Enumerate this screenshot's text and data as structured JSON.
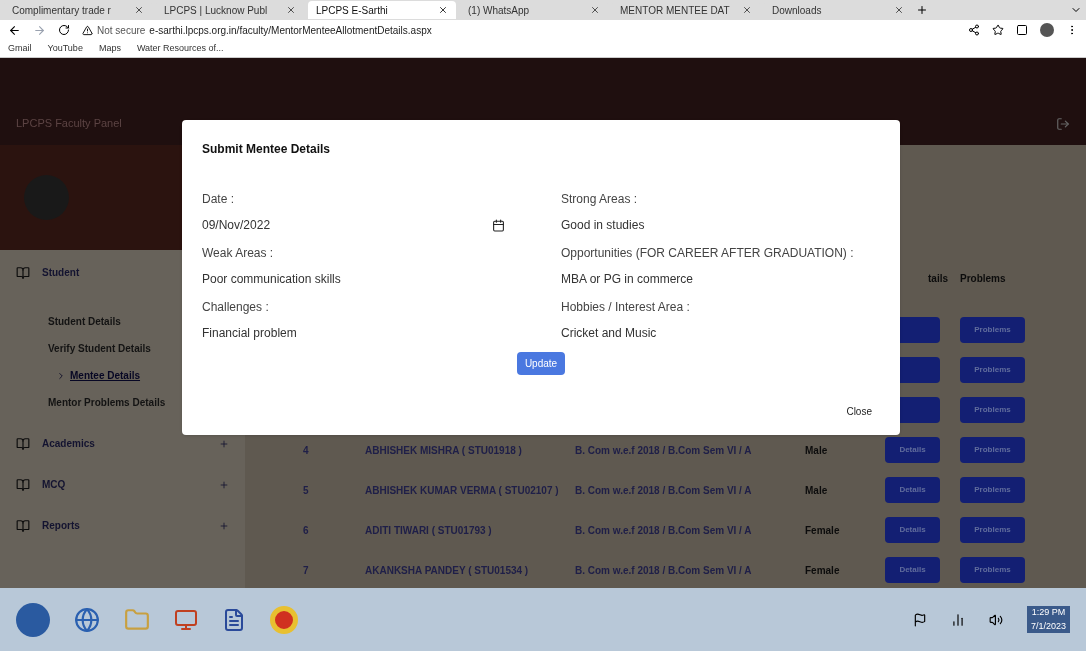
{
  "browser": {
    "tabs": [
      {
        "label": "Complimentary trade r",
        "selected": false
      },
      {
        "label": "LPCPS | Lucknow Publ",
        "selected": false
      },
      {
        "label": "LPCPS E-Sarthi",
        "selected": true
      },
      {
        "label": "(1) WhatsApp",
        "selected": false
      },
      {
        "label": "MENTOR MENTEE DAT",
        "selected": false
      },
      {
        "label": "Downloads",
        "selected": false
      }
    ],
    "security": "Not secure",
    "url": "e-sarthi.lpcps.org.in/faculty/MentorMenteeAllotmentDetails.aspx",
    "bookmarks": [
      "Gmail",
      "YouTube",
      "Maps",
      "Water Resources of..."
    ]
  },
  "header": {
    "title": "LPCPS Faculty Panel"
  },
  "sidebar": {
    "items": [
      {
        "label": "Student",
        "expanded": true,
        "children": [
          {
            "label": "Student Details",
            "selected": false
          },
          {
            "label": "Verify Student Details",
            "selected": false
          },
          {
            "label": "Mentee Details",
            "selected": true
          },
          {
            "label": "Mentor Problems Details",
            "selected": false
          }
        ]
      },
      {
        "label": "Academics",
        "expanded": false
      },
      {
        "label": "MCQ",
        "expanded": false
      },
      {
        "label": "Reports",
        "expanded": false
      }
    ]
  },
  "table": {
    "columns": [
      "tails",
      "Problems"
    ],
    "rows": [
      {
        "problems": "Problems"
      },
      {
        "problems": "Problems"
      },
      {
        "problems": "Problems"
      },
      {
        "no": "4",
        "name": "ABHISHEK MISHRA ( STU01918 )",
        "course": "B. Com w.e.f 2018 / B.Com Sem VI / A",
        "gender": "Male",
        "details": "Details",
        "problems": "Problems"
      },
      {
        "no": "5",
        "name": "ABHISHEK KUMAR VERMA ( STU02107 )",
        "course": "B. Com w.e.f 2018 / B.Com Sem VI / A",
        "gender": "Male",
        "details": "Details",
        "problems": "Problems"
      },
      {
        "no": "6",
        "name": "ADITI TIWARI ( STU01793 )",
        "course": "B. Com w.e.f 2018 / B.Com Sem VI / A",
        "gender": "Female",
        "details": "Details",
        "problems": "Problems"
      },
      {
        "no": "7",
        "name": "AKANKSHA PANDEY ( STU01534 )",
        "course": "B. Com w.e.f 2018 / B.Com Sem VI / A",
        "gender": "Female",
        "details": "Details",
        "problems": "Problems"
      }
    ]
  },
  "modal": {
    "title": "Submit Mentee Details",
    "left": [
      {
        "label": "Date :",
        "value": "09/Nov/2022",
        "kind": "date"
      },
      {
        "label": "Weak Areas :",
        "value": "Poor communication skills",
        "kind": "text"
      },
      {
        "label": "Challenges :",
        "value": "Financial problem",
        "kind": "text"
      }
    ],
    "right": [
      {
        "label": "Strong Areas :",
        "value": "Good in studies",
        "kind": "text"
      },
      {
        "label": "Opportunities (FOR CAREER AFTER GRADUATION) :",
        "value": "MBA or PG in commerce",
        "kind": "text"
      },
      {
        "label": "Hobbies / Interest Area :",
        "value": "Cricket and Music",
        "kind": "text"
      }
    ],
    "update_button": "Update",
    "close_button": "Close"
  },
  "taskbar": {
    "time": "1:29 PM",
    "date": "7/1/2023"
  }
}
